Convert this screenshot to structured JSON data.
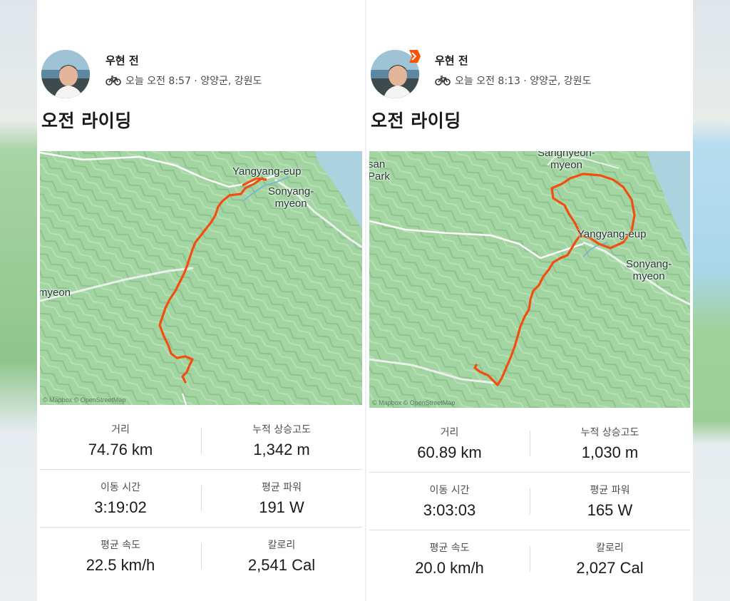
{
  "colors": {
    "route": "#f24e12",
    "accent_badge": "#fc5200",
    "map_green": "#a6d6a5",
    "water": "#aad3df"
  },
  "cards": [
    {
      "user_name": "우현 전",
      "activity_meta": "오늘 오전 8:57 · 양양군, 강원도",
      "activity_icon": "bicycle-icon",
      "title": "오전 라이딩",
      "map_labels": [
        "Yangyang-eup",
        "Sonyang-\nmyeon",
        "myeon"
      ],
      "attribution": "© Mapbox © OpenStreetMap",
      "stats": [
        {
          "label": "거리",
          "value": "74.76 km"
        },
        {
          "label": "누적 상승고도",
          "value": "1,342 m"
        },
        {
          "label": "이동 시간",
          "value": "3:19:02"
        },
        {
          "label": "평균 파워",
          "value": "191 W"
        },
        {
          "label": "평균 속도",
          "value": "22.5 km/h"
        },
        {
          "label": "칼로리",
          "value": "2,541 Cal"
        }
      ]
    },
    {
      "user_name": "우현 전",
      "activity_meta": "오늘 오전 8:13 · 양양군, 강원도",
      "activity_icon": "bicycle-icon",
      "badge_icon": "strava-chevron-icon",
      "title": "오전 라이딩",
      "map_labels": [
        "Sanghyeon-\nmyeon",
        "san\nPark",
        "Yangyang-eup",
        "Sonyang-\nmyeon"
      ],
      "attribution": "© Mapbox © OpenStreetMap",
      "stats": [
        {
          "label": "거리",
          "value": "60.89 km"
        },
        {
          "label": "누적 상승고도",
          "value": "1,030 m"
        },
        {
          "label": "이동 시간",
          "value": "3:03:03"
        },
        {
          "label": "평균 파워",
          "value": "165 W"
        },
        {
          "label": "평균 속도",
          "value": "20.0 km/h"
        },
        {
          "label": "칼로리",
          "value": "2,027 Cal"
        }
      ]
    }
  ]
}
